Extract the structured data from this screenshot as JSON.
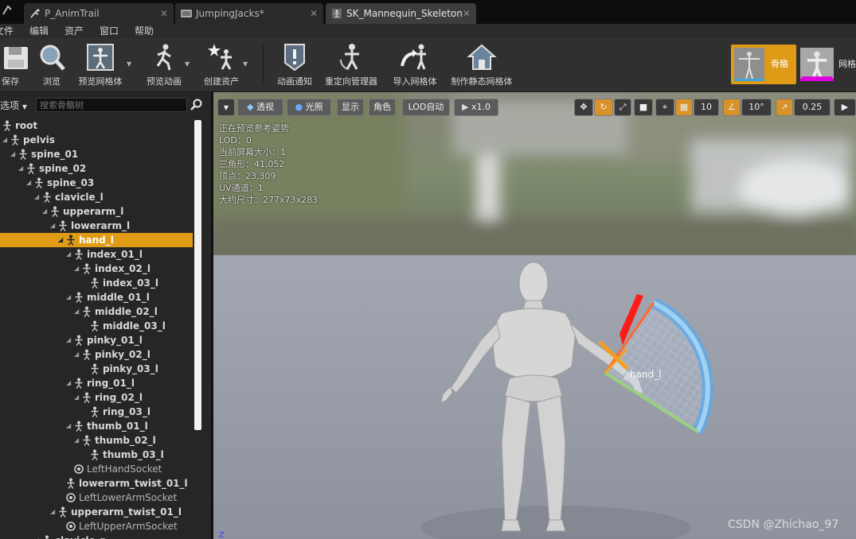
{
  "tabs": [
    {
      "label": "P_AnimTrail",
      "active": false
    },
    {
      "label": "JumpingJacks*",
      "active": false
    },
    {
      "label": "SK_Mannequin_Skeleton",
      "active": true
    }
  ],
  "menu": [
    "文件",
    "编辑",
    "资产",
    "窗口",
    "帮助"
  ],
  "toolbar": {
    "save": "保存",
    "browse": "浏览",
    "preview_mesh": "预览网格体",
    "preview_anim": "预览动画",
    "create_asset": "创建资产",
    "anim_notify": "动画通知",
    "retarget_manager": "重定向管理器",
    "import_mesh": "导入网格体",
    "make_static_mesh": "制作静态网格体"
  },
  "modes": {
    "skeleton": "骨骼",
    "mesh": "网格"
  },
  "left_panel": {
    "options_label": "选项",
    "search_placeholder": "搜索骨骼树",
    "tree": [
      {
        "label": "root",
        "depth": 0,
        "type": "bone",
        "expand": false
      },
      {
        "label": "pelvis",
        "depth": 1,
        "type": "bone",
        "expand": true
      },
      {
        "label": "spine_01",
        "depth": 2,
        "type": "bone",
        "expand": true
      },
      {
        "label": "spine_02",
        "depth": 3,
        "type": "bone",
        "expand": true
      },
      {
        "label": "spine_03",
        "depth": 4,
        "type": "bone",
        "expand": true
      },
      {
        "label": "clavicle_l",
        "depth": 5,
        "type": "bone",
        "expand": true
      },
      {
        "label": "upperarm_l",
        "depth": 6,
        "type": "bone",
        "expand": true
      },
      {
        "label": "lowerarm_l",
        "depth": 7,
        "type": "bone",
        "expand": true
      },
      {
        "label": "hand_l",
        "depth": 8,
        "type": "bone",
        "expand": true,
        "selected": true
      },
      {
        "label": "index_01_l",
        "depth": 9,
        "type": "bone",
        "expand": true
      },
      {
        "label": "index_02_l",
        "depth": 10,
        "type": "bone",
        "expand": true
      },
      {
        "label": "index_03_l",
        "depth": 11,
        "type": "bone",
        "expand": false
      },
      {
        "label": "middle_01_l",
        "depth": 9,
        "type": "bone",
        "expand": true
      },
      {
        "label": "middle_02_l",
        "depth": 10,
        "type": "bone",
        "expand": true
      },
      {
        "label": "middle_03_l",
        "depth": 11,
        "type": "bone",
        "expand": false
      },
      {
        "label": "pinky_01_l",
        "depth": 9,
        "type": "bone",
        "expand": true
      },
      {
        "label": "pinky_02_l",
        "depth": 10,
        "type": "bone",
        "expand": true
      },
      {
        "label": "pinky_03_l",
        "depth": 11,
        "type": "bone",
        "expand": false
      },
      {
        "label": "ring_01_l",
        "depth": 9,
        "type": "bone",
        "expand": true
      },
      {
        "label": "ring_02_l",
        "depth": 10,
        "type": "bone",
        "expand": true
      },
      {
        "label": "ring_03_l",
        "depth": 11,
        "type": "bone",
        "expand": false
      },
      {
        "label": "thumb_01_l",
        "depth": 9,
        "type": "bone",
        "expand": true
      },
      {
        "label": "thumb_02_l",
        "depth": 10,
        "type": "bone",
        "expand": true
      },
      {
        "label": "thumb_03_l",
        "depth": 11,
        "type": "bone",
        "expand": false
      },
      {
        "label": "LeftHandSocket",
        "depth": 9,
        "type": "socket",
        "expand": false
      },
      {
        "label": "lowerarm_twist_01_l",
        "depth": 8,
        "type": "bone",
        "expand": false
      },
      {
        "label": "LeftLowerArmSocket",
        "depth": 8,
        "type": "socket",
        "expand": false
      },
      {
        "label": "upperarm_twist_01_l",
        "depth": 7,
        "type": "bone",
        "expand": true
      },
      {
        "label": "LeftUpperArmSocket",
        "depth": 8,
        "type": "socket",
        "expand": false
      },
      {
        "label": "clavicle_r",
        "depth": 5,
        "type": "bone",
        "expand": true
      }
    ]
  },
  "viewport": {
    "buttons": {
      "perspective": "透视",
      "lit": "光照",
      "show": "显示",
      "character": "角色",
      "lod": "LOD自动",
      "speed": "x1.0",
      "grid_snap": "10",
      "rot_snap": "10°",
      "scale_snap": "0.25"
    },
    "stats": [
      "正在预览参考姿势",
      "LOD：0",
      "当前屏幕大小：1",
      "三角形：41,052",
      "顶点：23,309",
      "UV通道：1",
      "大约尺寸：277x73x283"
    ],
    "bone_label": "hand_l",
    "axis_label": "Z",
    "watermark": "CSDN @Zhichao_97"
  },
  "colors": {
    "accent": "#e09b16",
    "panel": "#262626",
    "toolbar": "#303030"
  }
}
